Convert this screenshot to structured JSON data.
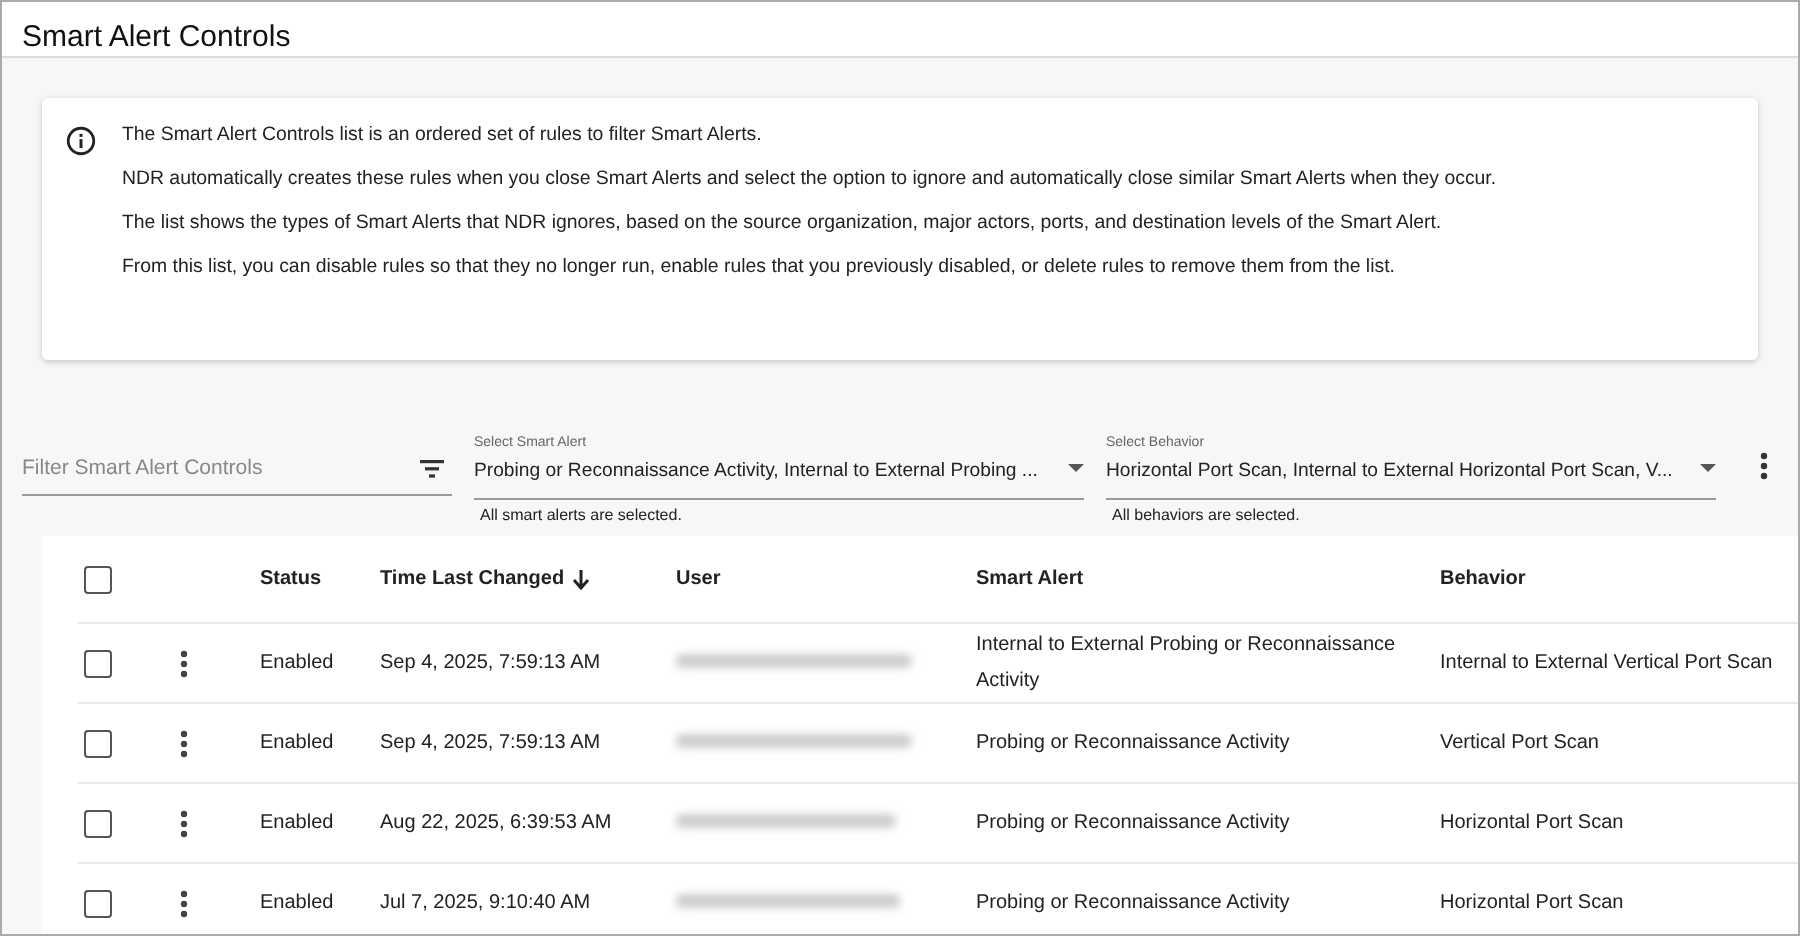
{
  "page_title": "Smart Alert Controls",
  "info": {
    "paragraphs": [
      "The Smart Alert Controls list is an ordered set of rules to filter Smart Alerts.",
      "NDR automatically creates these rules when you close Smart Alerts and select the option to ignore and automatically close similar Smart Alerts when they occur.",
      "The list shows the types of Smart Alerts that NDR ignores, based on the source organization, major actors, ports, and destination levels of the Smart Alert.",
      "From this list, you can disable rules so that they no longer run, enable rules that you previously disabled, or delete rules to remove them from the list."
    ]
  },
  "filter": {
    "placeholder": "Filter Smart Alert Controls"
  },
  "selects": [
    {
      "label": "Select Smart Alert",
      "value": "Probing or Reconnaissance Activity, Internal to External Probing ...",
      "hint": "All smart alerts are selected."
    },
    {
      "label": "Select Behavior",
      "value": "Horizontal Port Scan, Internal to External Horizontal Port Scan, V...",
      "hint": "All behaviors are selected."
    }
  ],
  "table": {
    "select_all_checked": false,
    "columns": [
      {
        "label": "Status",
        "sorted": false
      },
      {
        "label": "Time Last Changed",
        "sorted": true
      },
      {
        "label": "User",
        "sorted": false
      },
      {
        "label": "Smart Alert",
        "sorted": false
      },
      {
        "label": "Behavior",
        "sorted": false
      }
    ],
    "rows": [
      {
        "checked": false,
        "status": "Enabled",
        "time": "Sep 4, 2025, 7:59:13 AM",
        "smart_alert": "Internal to External Probing or Reconnaissance Activity",
        "behavior": "Internal to External Vertical Port Scan"
      },
      {
        "checked": false,
        "status": "Enabled",
        "time": "Sep 4, 2025, 7:59:13 AM",
        "smart_alert": "Probing or Reconnaissance Activity",
        "behavior": "Vertical Port Scan"
      },
      {
        "checked": false,
        "status": "Enabled",
        "time": "Aug 22, 2025, 6:39:53 AM",
        "smart_alert": "Probing or Reconnaissance Activity",
        "behavior": "Horizontal Port Scan"
      },
      {
        "checked": false,
        "status": "Enabled",
        "time": "Jul 7, 2025, 9:10:40 AM",
        "smart_alert": "Probing or Reconnaissance Activity",
        "behavior": "Horizontal Port Scan"
      }
    ]
  }
}
